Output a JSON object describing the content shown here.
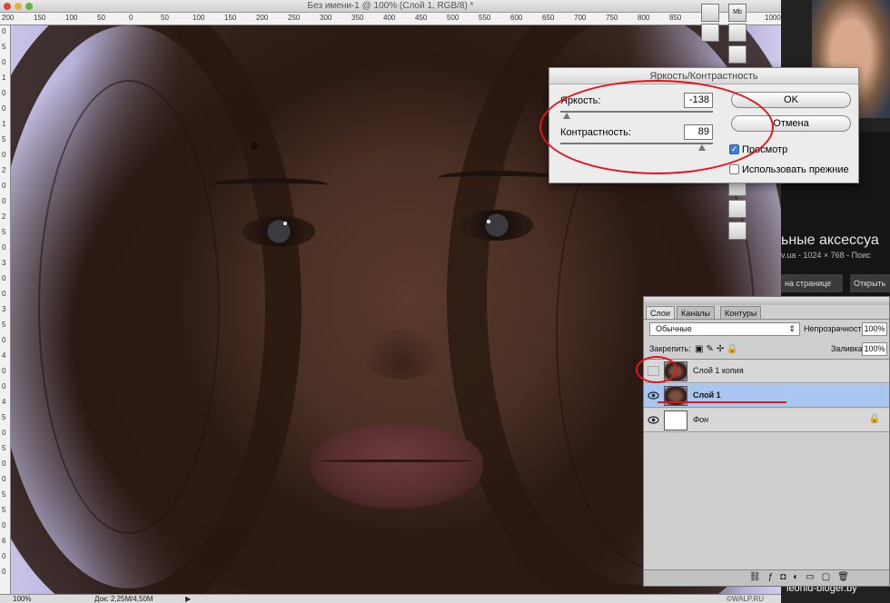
{
  "window": {
    "title": "Без имени-1 @ 100% (Слой 1, RGB/8) *"
  },
  "ruler": {
    "h_marks": [
      "200",
      "150",
      "100",
      "50",
      "0",
      "50",
      "100",
      "150",
      "200",
      "250",
      "300",
      "350",
      "400",
      "450",
      "500",
      "550",
      "600",
      "650",
      "700",
      "750",
      "800",
      "850",
      "900",
      "950",
      "1000"
    ],
    "v_marks": [
      "0",
      "5",
      "0",
      "1",
      "0",
      "0",
      "1",
      "5",
      "0",
      "2",
      "0",
      "0",
      "2",
      "5",
      "0",
      "3",
      "0",
      "0",
      "3",
      "5",
      "0",
      "4",
      "0",
      "0",
      "4",
      "5",
      "0",
      "5",
      "0",
      "0",
      "5",
      "5",
      "0",
      "6",
      "0",
      "0"
    ]
  },
  "dialog": {
    "title": "Яркость/Контрастность",
    "brightness_label": "Яркость:",
    "brightness_value": "-138",
    "contrast_label": "Контрастность:",
    "contrast_value": "89",
    "ok_label": "OK",
    "cancel_label": "Отмена",
    "preview_label": "Просмотр",
    "preview_checked": true,
    "legacy_label": "Использовать прежние",
    "legacy_checked": false,
    "brightness_level": -138,
    "contrast_level": 89
  },
  "layers_panel": {
    "tabs": [
      "Слои",
      "Каналы",
      "Контуры"
    ],
    "blend_mode": "Обычные",
    "opacity_label": "Непрозрачность:",
    "opacity_value": "100%",
    "lock_label": "Закрепить:",
    "fill_label": "Заливка:",
    "fill_value": "100%",
    "layers": [
      {
        "name": "Слой 1 копия",
        "visible": false,
        "selected": false
      },
      {
        "name": "Слой 1",
        "visible": true,
        "selected": true
      },
      {
        "name": "Фон",
        "visible": true,
        "selected": false,
        "locked": true
      }
    ]
  },
  "browser": {
    "text_line1": "ьные аксессуа",
    "text_line2": "v.ua - 1024 × 768 - Поис",
    "btn_page": "на странице",
    "btn_open": "Открыть",
    "watermark": "leonid-bloger.by"
  },
  "statusbar": {
    "zoom": "100%",
    "doc": "Док: 2,25M/4,50M",
    "credit": "©WALP.RU"
  },
  "colors": {
    "annotation": "#e3141a",
    "selected_layer": "#a8c6f0"
  }
}
